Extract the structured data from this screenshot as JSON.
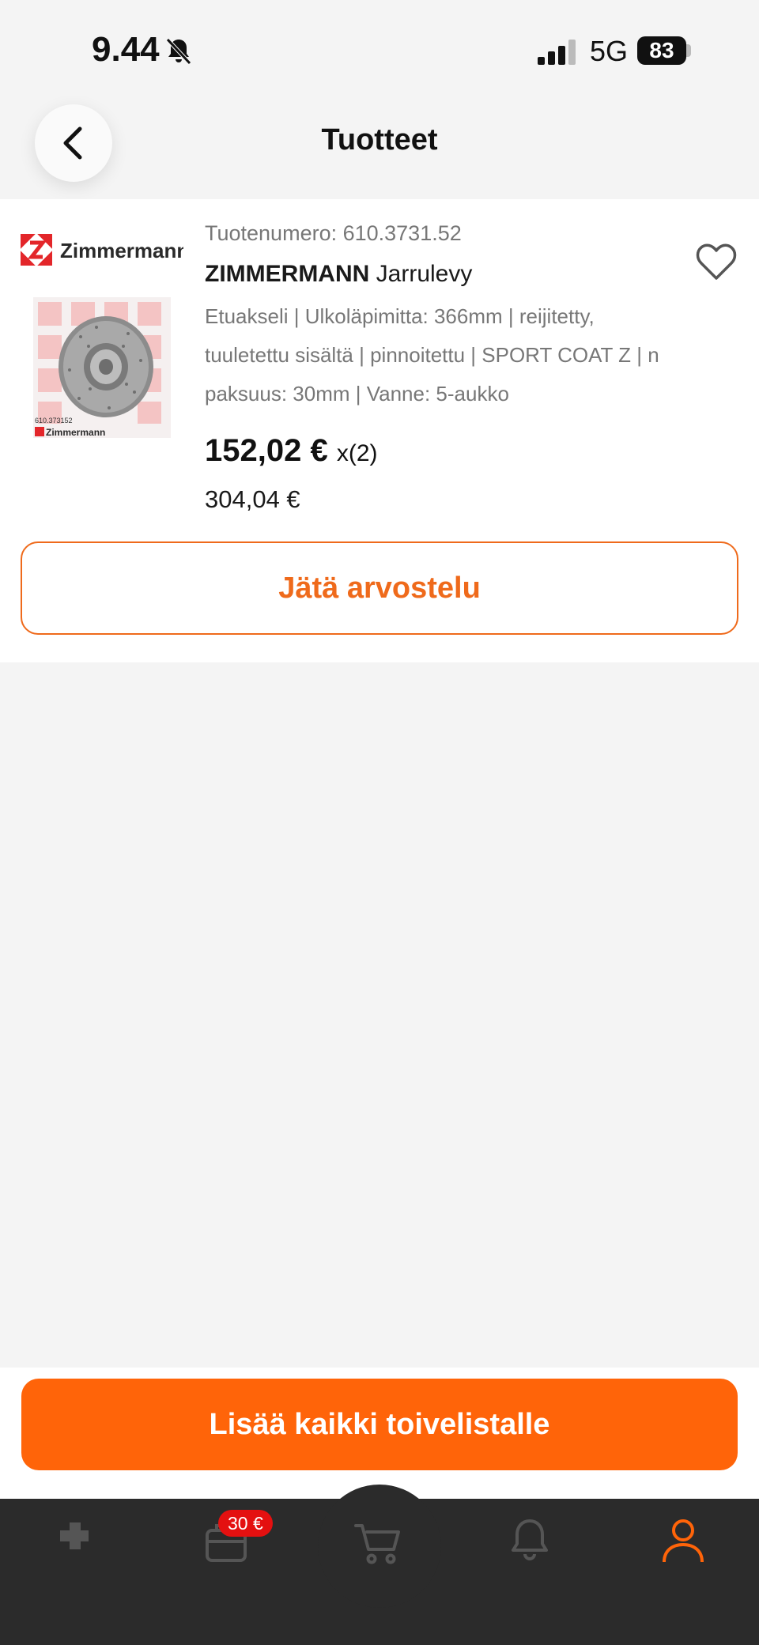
{
  "status_bar": {
    "time": "9.44",
    "network": "5G",
    "battery": "83"
  },
  "header": {
    "title": "Tuotteet"
  },
  "product": {
    "brand_logo_text": "Zimmermann",
    "sku_label": "Tuotenumero: 610.3731.52",
    "brand": "ZIMMERMANN",
    "name": "Jarrulevy",
    "description": "Etuakseli | Ulkoläpimitta: 366mm | reijitetty, tuuletettu sisältä | pinnoitettu | SPORT COAT Z | n paksuus: 30mm | Vanne: 5-aukko",
    "unit_price": "152,02 €",
    "quantity": "x(2)",
    "total_price": "304,04 €",
    "image_label": "610.373152"
  },
  "actions": {
    "review_label": "Jätä arvostelu",
    "wishlist_label": "Lisää kaikki toivelistalle"
  },
  "tab_bar": {
    "items": [
      {
        "icon": "puzzle-icon",
        "active": false
      },
      {
        "icon": "wallet-icon",
        "badge": "30 €",
        "active": false
      },
      {
        "icon": "cart-icon",
        "active": false
      },
      {
        "icon": "bell-icon",
        "active": false
      },
      {
        "icon": "user-icon",
        "active": true
      }
    ]
  },
  "colors": {
    "accent": "#ff6409",
    "accent_outline": "#ef6a1b",
    "tab_bar": "#2b2b2b",
    "badge": "#e41010"
  }
}
